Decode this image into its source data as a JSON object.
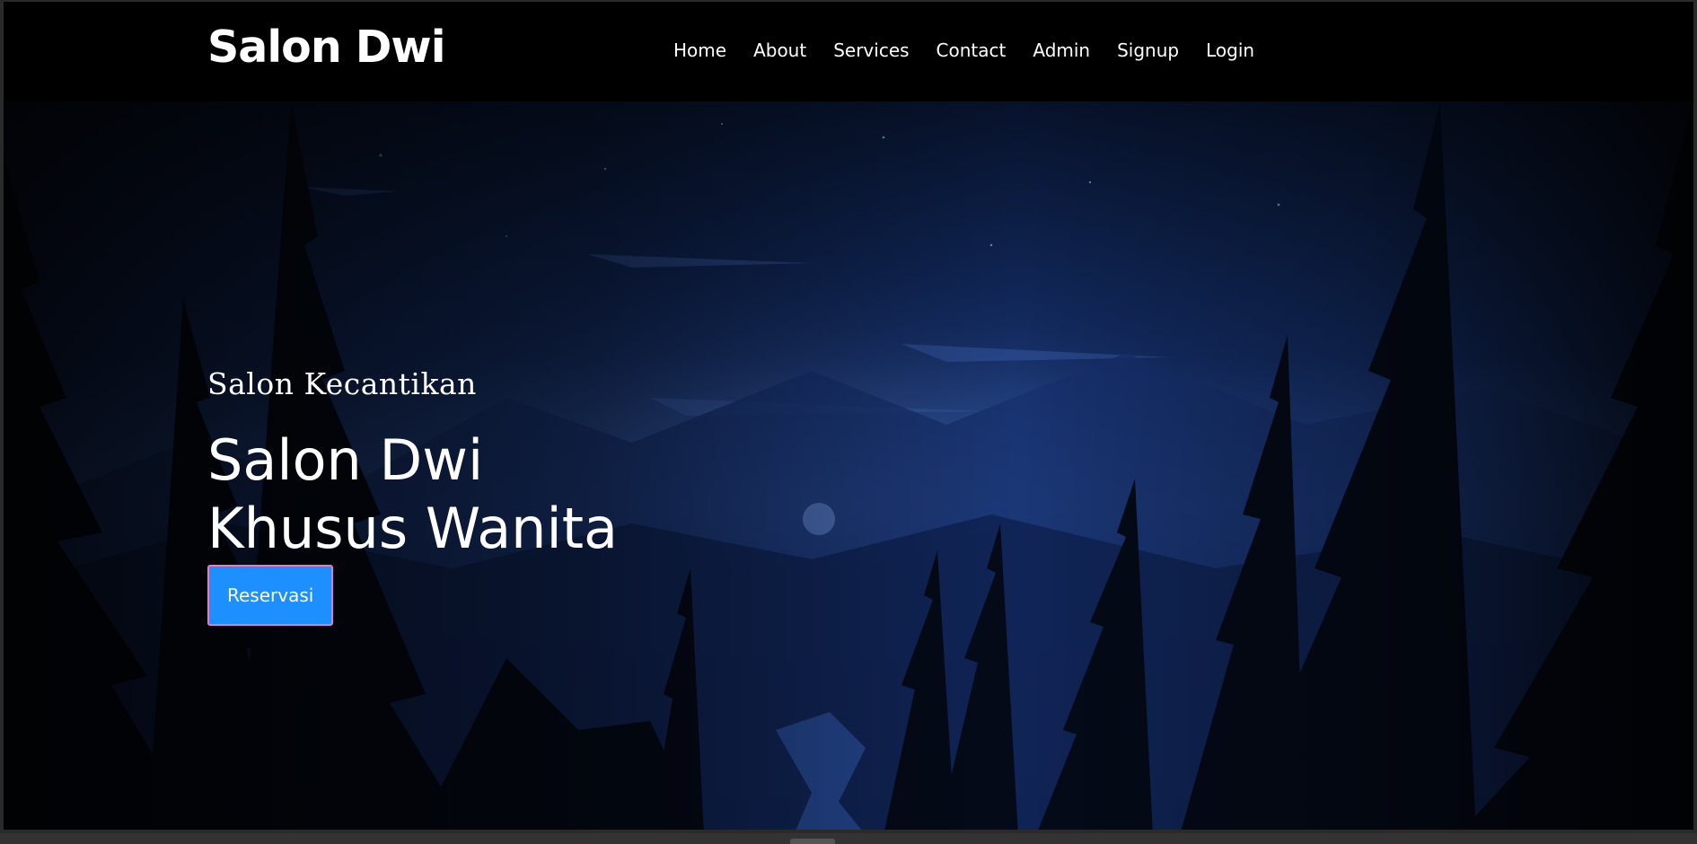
{
  "navbar": {
    "brand": "Salon Dwi",
    "links": [
      {
        "label": "Home"
      },
      {
        "label": "About"
      },
      {
        "label": "Services"
      },
      {
        "label": "Contact"
      },
      {
        "label": "Admin"
      },
      {
        "label": "Signup"
      },
      {
        "label": "Login"
      }
    ]
  },
  "hero": {
    "subtitle": "Salon Kecantikan",
    "headline_line1": "Salon Dwi",
    "headline_line2": "Khusus Wanita",
    "cta_label": "Reservasi"
  },
  "colors": {
    "navbar_bg": "#000000",
    "cta_bg": "#1e8fff",
    "cta_border": "#e879c4",
    "sky_top": "#0b1a3a",
    "sky_mid": "#1d3f8a"
  }
}
